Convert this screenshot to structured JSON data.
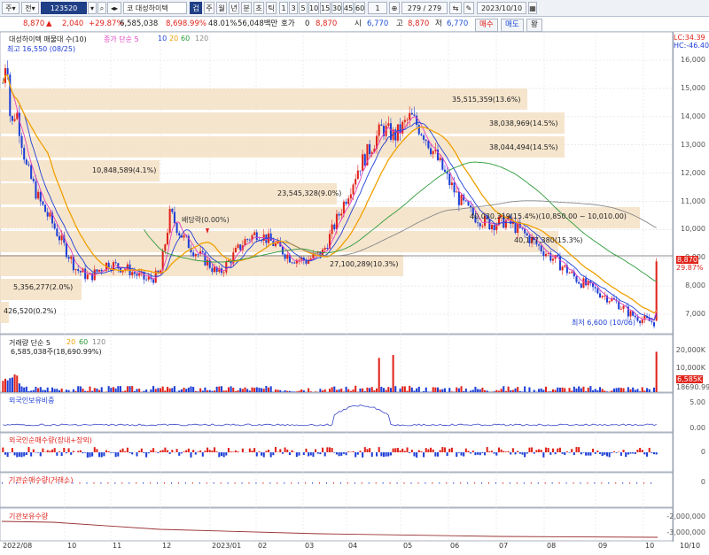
{
  "toolbar": {
    "btn_first": "주",
    "btn_second": "전",
    "stock_code": "123520",
    "stock_prefix": "코",
    "stock_name": "대성하이텍",
    "btn_g": "겁",
    "periods": [
      "주",
      "월",
      "년",
      "분",
      "초",
      "틱"
    ],
    "minutes": [
      "1",
      "3",
      "5",
      "10",
      "15",
      "30",
      "45",
      "60"
    ],
    "count_value": "1",
    "range": "279 / 279",
    "date": "2023/10/10"
  },
  "infobar": {
    "price": "8,870",
    "change": "2,040",
    "change_pct": "+29.87%",
    "volume": "6,585,038",
    "volume_ratio": "8,698.99%",
    "pct2": "48.01%",
    "trade_value": "56,048백만",
    "hoga_label": "호가",
    "hoga_value": "0",
    "price2": "8,870",
    "open_label": "시",
    "open_value": "6,770",
    "high_label": "고",
    "high_value": "8,870",
    "low_label": "저",
    "low_value": "6,770",
    "buy_btn": "매수",
    "sell_btn": "매도",
    "menu_btn": "왕"
  },
  "price_pane": {
    "title": "대성하이텍 매물대 수(10)",
    "ma_legend": [
      "종가 단순 5",
      "10",
      "20",
      "60",
      "120"
    ],
    "high_annot": "최고 16,550 (08/25)",
    "low_annot": "최저 6,600 (10/06)",
    "dividend_annot": "배당락(0.00%)",
    "hc_value": "HC:-46.40",
    "lc_value": "LC:34.39",
    "current_price_tag": "8,870",
    "current_pct_tag": "29.87%",
    "volume_profile": [
      "35,515,359(13.6%)",
      "38,038,969(14.5%)",
      "38,044,494(14.5%)",
      "10,848,589(4.1%)",
      "23,545,328(9.0%)",
      "40,030,319(15.4%)(10,850.00 ~ 10,010.00)",
      "40,177,380(15.3%)",
      "27,100,289(10.3%)",
      "5,356,277(2.0%)",
      "426,520(0.2%)"
    ],
    "y_labels": [
      "16,000",
      "15,000",
      "14,000",
      "13,000",
      "12,000",
      "11,000",
      "10,000",
      "9,000",
      "8,000",
      "7,000"
    ]
  },
  "volume_pane": {
    "title": "거래량 단순 5",
    "ma_legend": [
      "20",
      "60",
      "120"
    ],
    "current_value": "6,585,038주(18,690.99%)",
    "y_labels": [
      "20,000K",
      "10,000K"
    ],
    "tag1": "6,585K",
    "tag2": "18690.99%"
  },
  "foreign_pane": {
    "title": "외국인보유비중",
    "y_labels": [
      "5.00",
      "0.00"
    ]
  },
  "foreign_net_pane": {
    "title": "외국인순매수량(장내+장외)",
    "y_label": "0"
  },
  "inst_net_pane": {
    "title": "기관순매수량(거래소)",
    "y_label": "0"
  },
  "inst_hold_pane": {
    "title": "기관보유수량",
    "y_labels": [
      "-2,000,000",
      "-3,000,000"
    ]
  },
  "x_labels": [
    "2022/08",
    "10",
    "11",
    "12",
    "2023/01",
    "02",
    "03",
    "04",
    "05",
    "06",
    "07",
    "08",
    "09",
    "10",
    "10/10"
  ],
  "colors": {
    "up": "#e0231b",
    "down": "#1f3fd6",
    "ma5": "#e040c0",
    "ma10": "#1f3fd6",
    "ma20": "#f0a000",
    "ma60": "#2e9a3a",
    "ma120": "#888888",
    "volume_profile_band": "#f5e1c4"
  }
}
